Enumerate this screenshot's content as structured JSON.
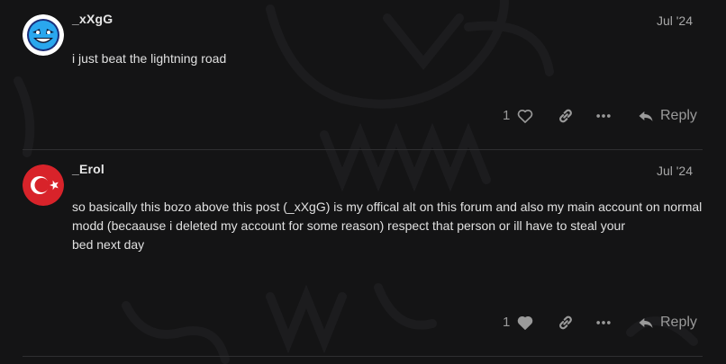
{
  "posts": [
    {
      "username": "_xXgG",
      "date": "Jul '24",
      "body": [
        "i just beat the lightning road"
      ],
      "like_count": "1",
      "liked": false,
      "reply_label": "Reply",
      "avatar": "geometry-dash-face-avatar"
    },
    {
      "username": "_Erol",
      "date": "Jul '24",
      "body": [
        "so basically this bozo above this post (_xXgG) is my offical alt on this forum and also my main account on normal modd (becaause i deleted my account for some reason) respect that person or ill have to steal your",
        "bed next day"
      ],
      "like_count": "1",
      "liked": true,
      "reply_label": "Reply",
      "avatar": "turkish-flag-avatar"
    }
  ],
  "colors": {
    "background": "#141415",
    "text": "#e0e0e0",
    "muted": "#9a9a9a",
    "divider": "#2f2f31",
    "avatar_blue": "#1f8fe0",
    "avatar_red": "#d8232a"
  }
}
